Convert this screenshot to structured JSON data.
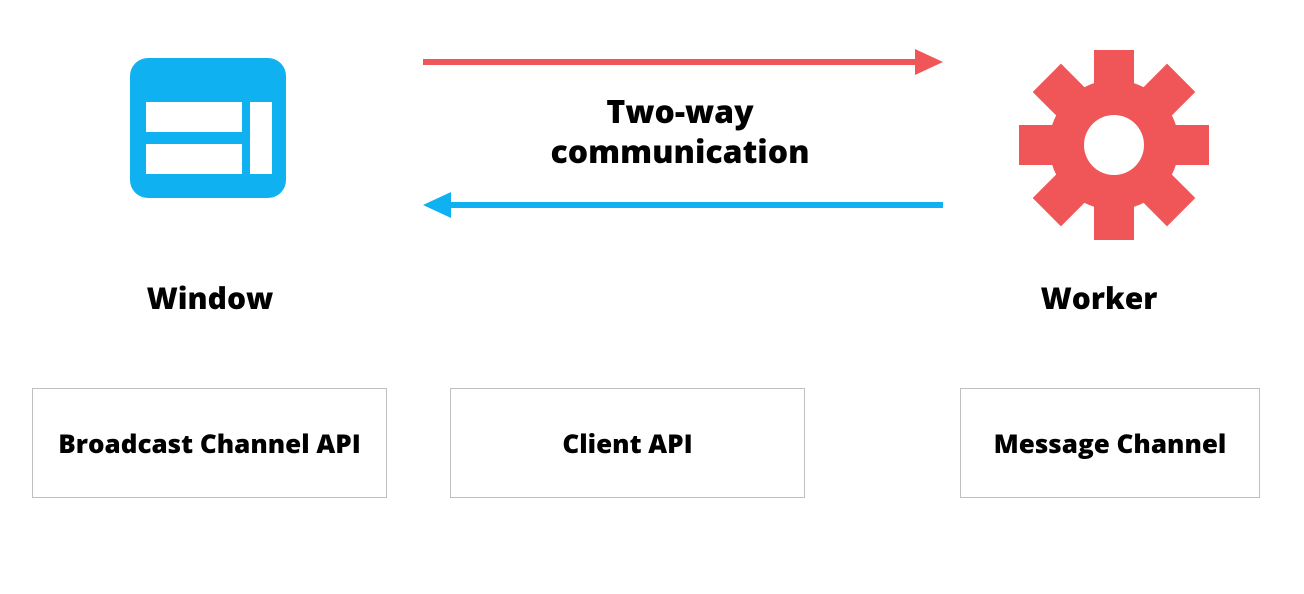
{
  "nodes": {
    "window_label": "Window",
    "worker_label": "Worker"
  },
  "center_label_line1": "Two-way",
  "center_label_line2": "communication",
  "boxes": {
    "left": "Broadcast Channel API",
    "mid": "Client API",
    "right": "Message Channel"
  },
  "colors": {
    "blue": "#0fb1f0",
    "red": "#f05658",
    "box_border": "#bfbfbf"
  },
  "arrows": {
    "top": {
      "direction": "right",
      "color": "red"
    },
    "bottom": {
      "direction": "left",
      "color": "blue"
    }
  }
}
